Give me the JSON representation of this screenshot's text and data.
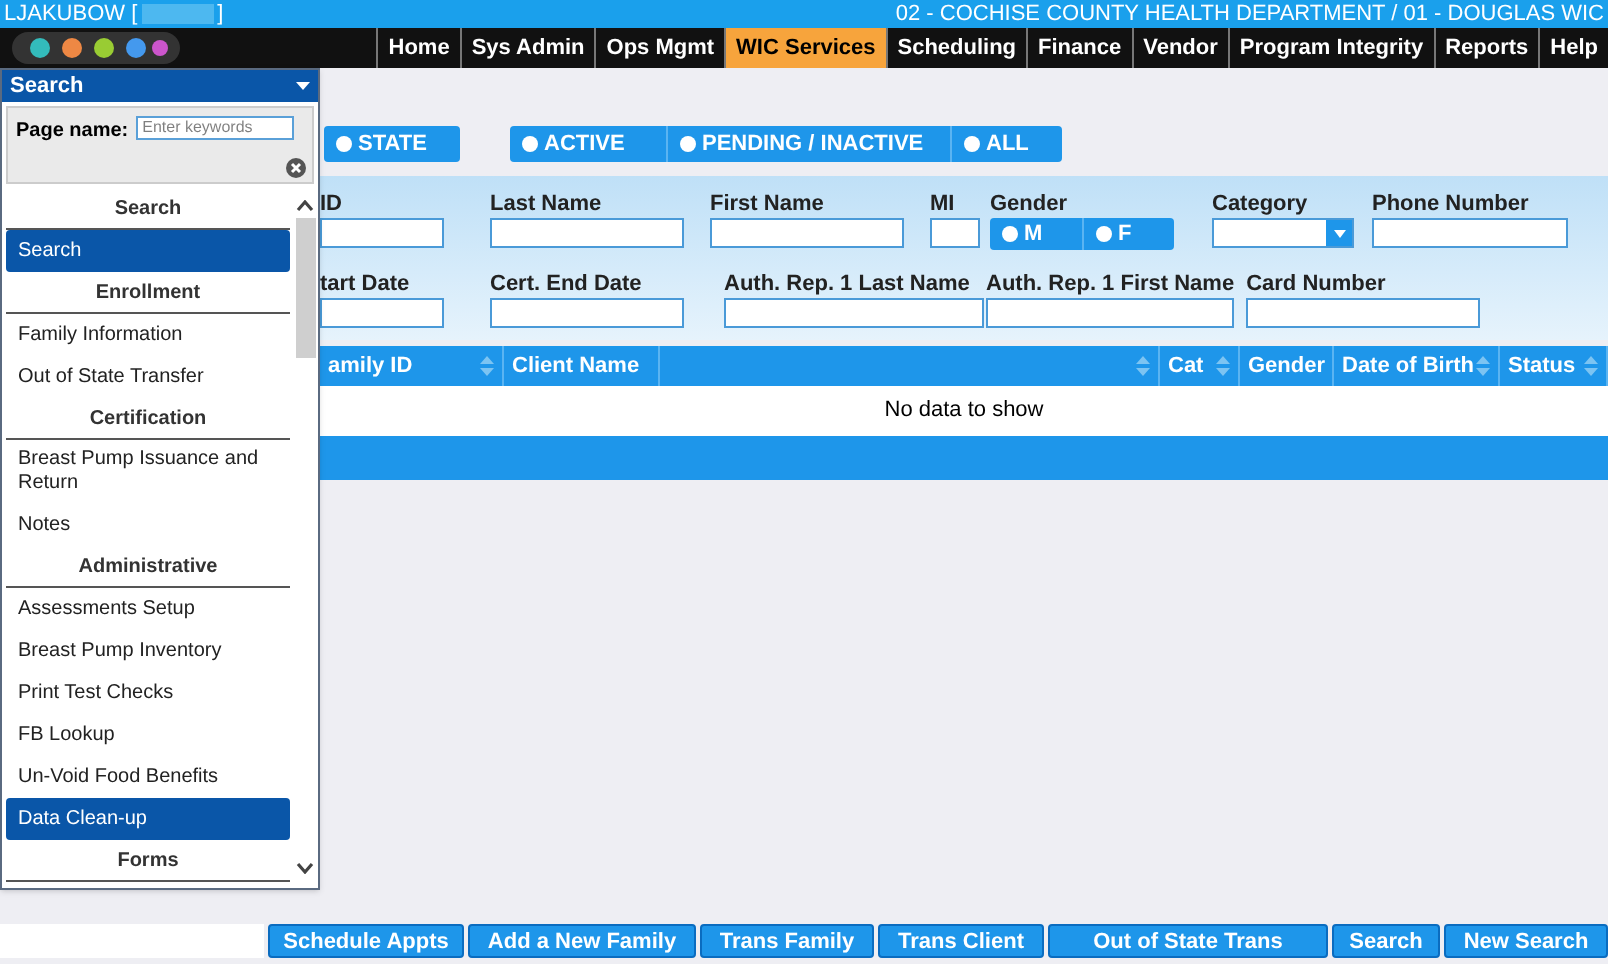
{
  "top_bar": {
    "user": "LJAKUBOW [",
    "user_end": "]",
    "location": "02 - COCHISE COUNTY HEALTH DEPARTMENT / 01 - DOUGLAS WIC"
  },
  "nav": [
    {
      "label": "Home",
      "selected": false
    },
    {
      "label": "Sys Admin",
      "selected": false
    },
    {
      "label": "Ops Mgmt",
      "selected": false
    },
    {
      "label": "WIC Services",
      "selected": true
    },
    {
      "label": "Scheduling",
      "selected": false
    },
    {
      "label": "Finance",
      "selected": false
    },
    {
      "label": "Vendor",
      "selected": false
    },
    {
      "label": "Program Integrity",
      "selected": false
    },
    {
      "label": "Reports",
      "selected": false
    },
    {
      "label": "Help",
      "selected": false
    }
  ],
  "menu_panel": {
    "title": "Search",
    "page_name_label": "Page name:",
    "placeholder": "Enter keywords",
    "sections": [
      {
        "heading": "Search",
        "items": [
          {
            "label": "Search",
            "selected": true
          }
        ]
      },
      {
        "heading": "Enrollment",
        "items": [
          {
            "label": "Family Information",
            "selected": false
          },
          {
            "label": "Out of State Transfer",
            "selected": false
          }
        ]
      },
      {
        "heading": "Certification",
        "items": [
          {
            "label": "Breast Pump Issuance and Return",
            "selected": false
          },
          {
            "label": "Notes",
            "selected": false
          }
        ]
      },
      {
        "heading": "Administrative",
        "items": [
          {
            "label": "Assessments Setup",
            "selected": false
          },
          {
            "label": "Breast Pump Inventory",
            "selected": false
          },
          {
            "label": "Print Test Checks",
            "selected": false
          },
          {
            "label": "FB Lookup",
            "selected": false
          },
          {
            "label": "Un-Void Food Benefits",
            "selected": false
          },
          {
            "label": "Data Clean-up",
            "selected": true
          }
        ]
      },
      {
        "heading": "Forms"
      }
    ]
  },
  "scope_toggle": [
    {
      "label": "STATE",
      "selected": false
    }
  ],
  "status_toggle": [
    {
      "label": "ACTIVE",
      "selected": false
    },
    {
      "label": "PENDING / INACTIVE",
      "selected": false
    },
    {
      "label": "ALL",
      "selected": false
    }
  ],
  "search_form": {
    "row_1": [
      {
        "label": "ID",
        "kind": "text"
      },
      {
        "label": "Last Name",
        "kind": "text"
      },
      {
        "label": "First Name",
        "kind": "text"
      },
      {
        "label": "MI",
        "kind": "text"
      },
      {
        "label": "Gender",
        "kind": "gender",
        "options": [
          {
            "label": "M",
            "selected": false
          },
          {
            "label": "F",
            "selected": false
          }
        ]
      },
      {
        "label": "Category",
        "kind": "select"
      },
      {
        "label": "Phone Number",
        "kind": "text"
      }
    ],
    "row_2": [
      {
        "label": "tart Date",
        "kind": "text"
      },
      {
        "label": "Cert. End Date",
        "kind": "text"
      },
      {
        "label": "Auth. Rep. 1 Last Name",
        "kind": "text"
      },
      {
        "label": "Auth. Rep. 1 First Name",
        "kind": "text"
      },
      {
        "label": "Card Number",
        "kind": "text"
      }
    ]
  },
  "table": {
    "columns": [
      {
        "label": "amily ID",
        "sortable": true
      },
      {
        "label": "Client Name",
        "sortable": false
      },
      {
        "sortable": true
      },
      {
        "label": "Cat",
        "sortable": true
      },
      {
        "label": "Gender",
        "sortable": false
      },
      {
        "label": "Date of Birth",
        "sortable": true
      },
      {
        "label": "Status",
        "sortable": true
      }
    ],
    "empty_message": "No data to show"
  },
  "buttons": [
    "Schedule Appts",
    "Add a New Family",
    "Trans Family",
    "Trans Client",
    "Out of State Trans",
    "Search",
    "New Search"
  ]
}
